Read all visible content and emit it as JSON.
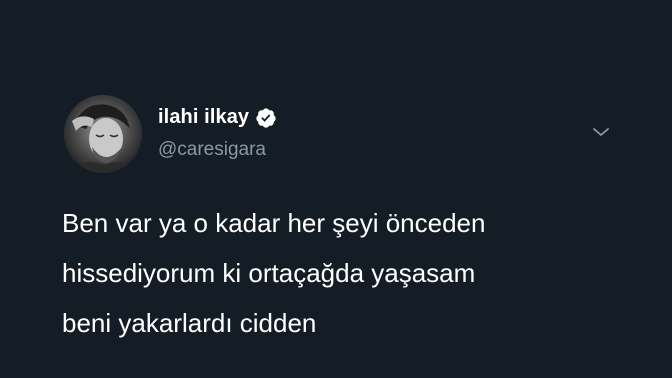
{
  "tweet": {
    "author": {
      "display_name": "ilahi ilkay",
      "handle": "@caresigara",
      "verified": true,
      "avatar_icon": "user-avatar"
    },
    "menu_icon": "chevron-down-icon",
    "text_lines": [
      "Ben var ya o kadar her şeyi önceden",
      "hissediyorum ki ortaçağda yaşasam",
      "beni yakarlardı cidden"
    ]
  },
  "colors": {
    "background": "#141d26",
    "text": "#ffffff",
    "handle": "#8899a6",
    "chevron": "#8899a6"
  }
}
